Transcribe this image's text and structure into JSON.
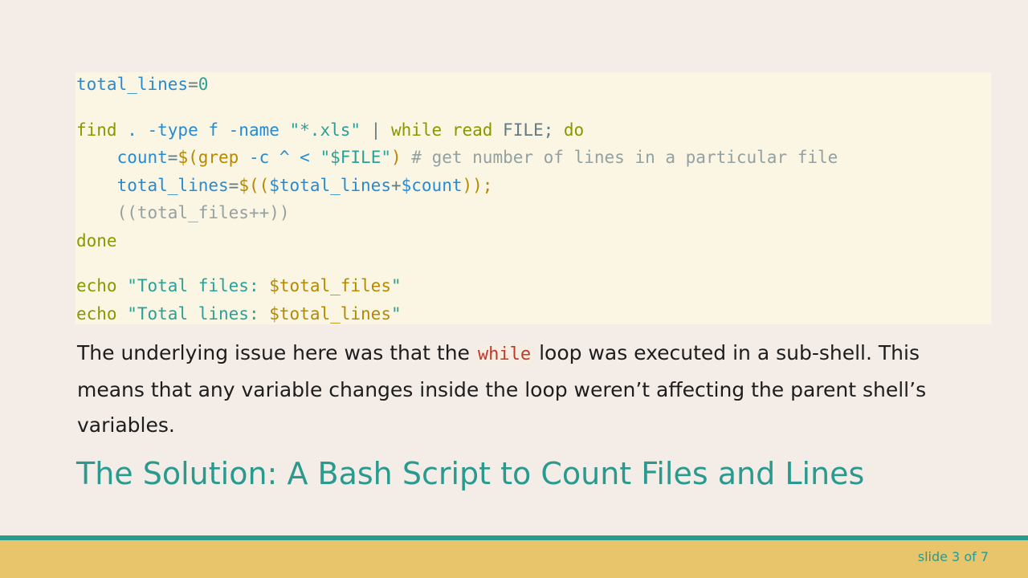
{
  "code": {
    "line1": {
      "v": "total_lines",
      "eq": "=",
      "n": "0"
    },
    "line2": {
      "find": "find",
      "mid": " . -type f -name ",
      "pattern": "\"*.xls\"",
      "pipe": " | ",
      "while_read": "while read",
      "file": " FILE;",
      "do": " do"
    },
    "line3": {
      "indent": "    ",
      "count": "count",
      "eq": "=",
      "sub_open": "$(",
      "grep": "grep",
      "args": " -c ^ < ",
      "file": "\"$FILE\"",
      "sub_close": ")",
      "comment": " # get number of lines in a particular file"
    },
    "line4": {
      "indent": "    ",
      "var": "total_lines",
      "eq": "=",
      "open": "$((",
      "a": "$total_lines",
      "plus": "+",
      "b": "$count",
      "close": "));"
    },
    "line5": {
      "indent": "    ",
      "text": "((total_files++))"
    },
    "line6": {
      "done": "done"
    },
    "line7": {
      "echo": "echo",
      "sp": " ",
      "q1": "\"Total files: ",
      "var": "$total_files",
      "q2": "\""
    },
    "line8": {
      "echo": "echo",
      "sp": " ",
      "q1": "\"Total lines: ",
      "var": "$total_lines",
      "q2": "\""
    }
  },
  "prose": {
    "part1": "The underlying issue here was that the ",
    "inline_code": "while",
    "part2": " loop was executed in a sub-shell. This means that any variable changes inside the loop weren’t affecting the parent shell’s variables."
  },
  "heading": "The Solution: A Bash Script to Count Files and Lines",
  "footer": {
    "slide_counter": "slide 3 of 7"
  },
  "colors": {
    "background": "#f3ece7",
    "code_background": "#fbf5e3",
    "accent_teal": "#2a9a8f",
    "footer_gold": "#e8c46b"
  }
}
